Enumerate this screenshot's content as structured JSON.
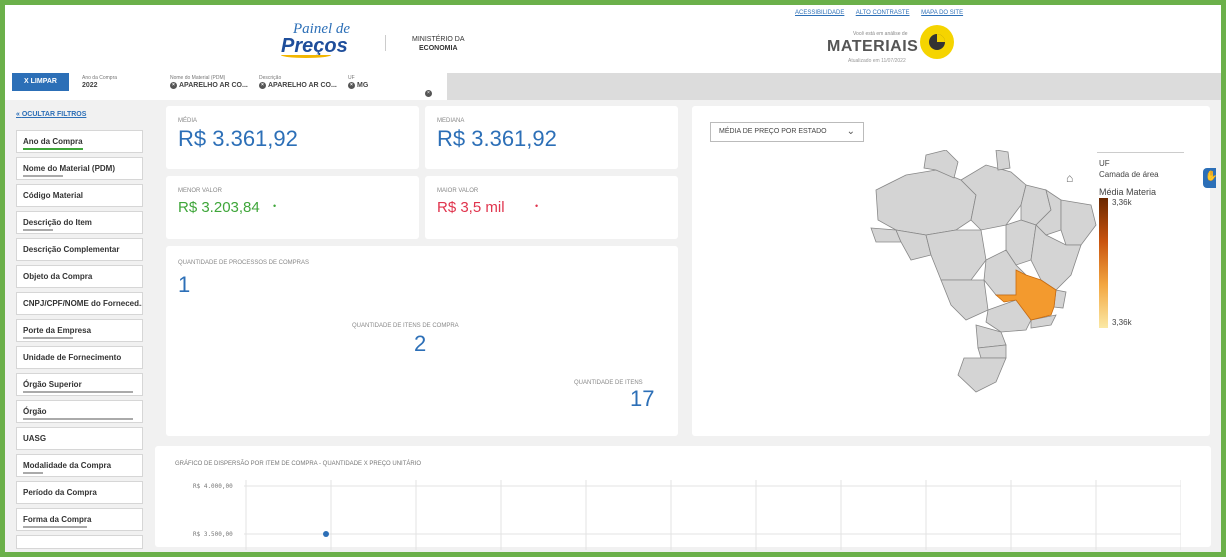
{
  "header": {
    "logo_line1": "Painel de",
    "logo_line2": "Preços",
    "ministry_line1": "MINISTÉRIO DA",
    "ministry_line2": "ECONOMIA",
    "top_links": [
      "ACESSIBILIDADE",
      "ALTO CONTRASTE",
      "MAPA DO SITE"
    ],
    "analysis_label": "Você está em análise de",
    "analysis_title": "MATERIAIS",
    "updated": "Atualizado em 11/07/2022",
    "brand_color": "#f5d400"
  },
  "filters": {
    "clear_label": "X LIMPAR",
    "chips": [
      {
        "label": "Ano da Compra",
        "value": "2022"
      },
      {
        "label": "Nome do Material (PDM)",
        "value": "APARELHO AR CO..."
      },
      {
        "label": "Descrição",
        "value": "APARELHO AR CO..."
      },
      {
        "label": "UF",
        "value": "MG"
      }
    ]
  },
  "sidebar": {
    "hide_label": "OCULTAR FILTROS",
    "items": [
      "Ano da Compra",
      "Nome do Material (PDM)",
      "Código Material",
      "Descrição do Item",
      "Descrição Complementar",
      "Objeto da Compra",
      "CNPJ/CPF/NOME do Forneced...",
      "Porte da Empresa",
      "Unidade de Fornecimento",
      "Órgão Superior",
      "Órgão",
      "UASG",
      "Modalidade da Compra",
      "Período da Compra",
      "Forma da Compra"
    ]
  },
  "kpis": {
    "media_label": "MÉDIA",
    "media_value": "R$ 3.361,92",
    "mediana_label": "MEDIANA",
    "mediana_value": "R$ 3.361,92",
    "menor_label": "MENOR VALOR",
    "menor_value": "R$ 3.203,84",
    "maior_label": "MAIOR VALOR",
    "maior_value": "R$ 3,5 mil",
    "qtd_processos_label": "QUANTIDADE DE PROCESSOS DE COMPRAS",
    "qtd_processos_value": "1",
    "qtd_itens_compra_label": "QUANTIDADE DE ITENS DE COMPRA",
    "qtd_itens_compra_value": "2",
    "qtd_itens_label": "QUANTIDADE DE ITENS",
    "qtd_itens_value": "17",
    "green": "#3fa63a",
    "red": "#e0344d",
    "blue": "#2c6fb7"
  },
  "map": {
    "dropdown": "MÉDIA DE PREÇO POR ESTADO",
    "legend_uf": "UF",
    "legend_layer": "Camada de área",
    "legend_metric": "Média Materia",
    "legend_max": "3,36k",
    "legend_min": "3,36k",
    "highlight_state": "MG",
    "highlight_color": "#f39a2e"
  },
  "scatter": {
    "title": "GRÁFICO DE DISPERSÃO POR ITEM DE COMPRA - QUANTIDADE X PREÇO UNITÁRIO",
    "ytick_labels": [
      "R$ 4.000,00",
      "R$ 3.500,00"
    ]
  },
  "chart_data": {
    "type": "scatter",
    "title": "GRÁFICO DE DISPERSÃO POR ITEM DE COMPRA - QUANTIDADE X PREÇO UNITÁRIO",
    "xlabel": "",
    "ylabel": "",
    "yticks": [
      4000,
      3500
    ],
    "points": [
      {
        "x": 1,
        "y": 3500
      }
    ]
  }
}
